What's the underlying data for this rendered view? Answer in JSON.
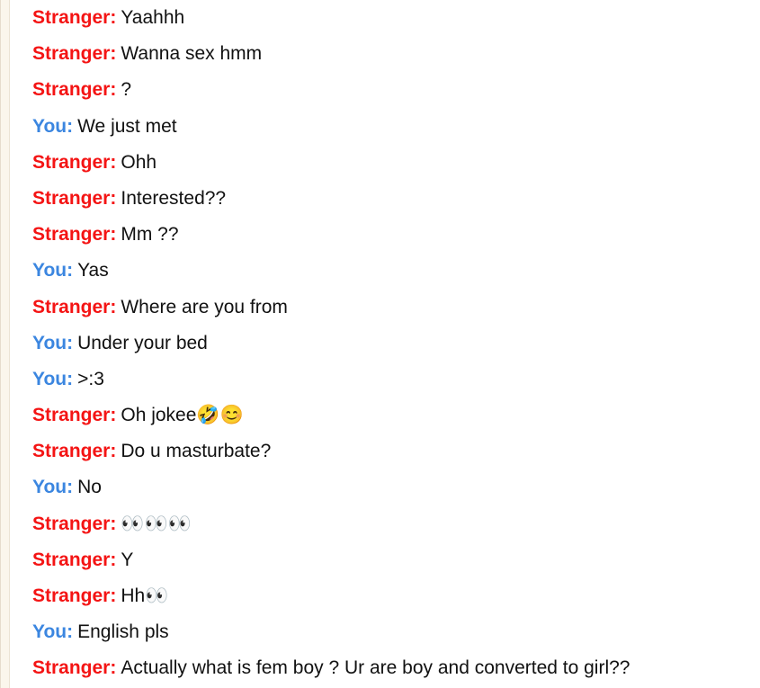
{
  "colors": {
    "stranger": "#f41414",
    "you": "#3b86e0",
    "text": "#111111"
  },
  "messages": [
    {
      "sender": "Stranger:",
      "role": "stranger",
      "text": "Yaahhh"
    },
    {
      "sender": "Stranger:",
      "role": "stranger",
      "text": "Wanna sex hmm"
    },
    {
      "sender": "Stranger:",
      "role": "stranger",
      "text": "?"
    },
    {
      "sender": "You:",
      "role": "you",
      "text": "We just met"
    },
    {
      "sender": "Stranger:",
      "role": "stranger",
      "text": "Ohh"
    },
    {
      "sender": "Stranger:",
      "role": "stranger",
      "text": "Interested??"
    },
    {
      "sender": "Stranger:",
      "role": "stranger",
      "text": "Mm ??"
    },
    {
      "sender": "You:",
      "role": "you",
      "text": "Yas"
    },
    {
      "sender": "Stranger:",
      "role": "stranger",
      "text": "Where are you from"
    },
    {
      "sender": "You:",
      "role": "you",
      "text": "Under your bed"
    },
    {
      "sender": "You:",
      "role": "you",
      "text": ">:3"
    },
    {
      "sender": "Stranger:",
      "role": "stranger",
      "text": "Oh jokee🤣😊"
    },
    {
      "sender": "Stranger:",
      "role": "stranger",
      "text": "Do u masturbate?"
    },
    {
      "sender": "You:",
      "role": "you",
      "text": "No"
    },
    {
      "sender": "Stranger:",
      "role": "stranger",
      "text": "👀👀👀"
    },
    {
      "sender": "Stranger:",
      "role": "stranger",
      "text": "Y"
    },
    {
      "sender": "Stranger:",
      "role": "stranger",
      "text": "Hh👀"
    },
    {
      "sender": "You:",
      "role": "you",
      "text": "English pls"
    },
    {
      "sender": "Stranger:",
      "role": "stranger",
      "text": "Actually what is fem boy ? Ur are boy and converted to girl??"
    }
  ]
}
